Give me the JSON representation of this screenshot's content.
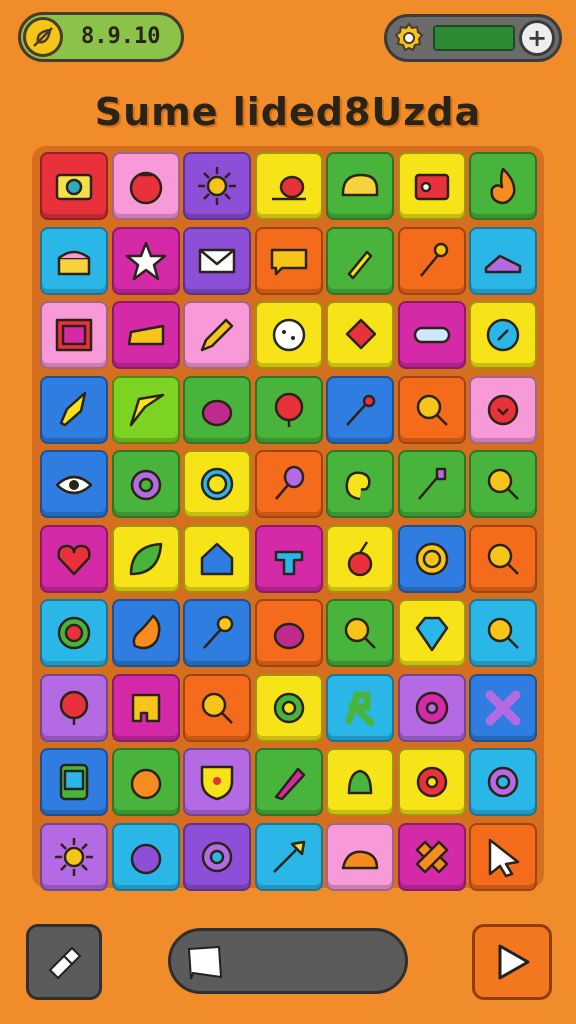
{
  "hud": {
    "coins": "8.9.10",
    "coin_icon": "leaf-icon",
    "settings_icon": "gear-icon",
    "add_icon": "plus-icon",
    "energy_level": 1.0
  },
  "title": "Sume lided8Uzda",
  "board": {
    "rows": 9,
    "cols": 7,
    "tiles": [
      [
        "red",
        "camera-icon"
      ],
      [
        "pink",
        "tomato-icon"
      ],
      [
        "purple",
        "sun-icon"
      ],
      [
        "yellow",
        "snail-icon"
      ],
      [
        "green",
        "bread-icon"
      ],
      [
        "yellow",
        "radio-icon"
      ],
      [
        "green",
        "flame-icon"
      ],
      [
        "cyan",
        "cake-icon"
      ],
      [
        "magenta",
        "star-icon"
      ],
      [
        "purple",
        "envelope-icon"
      ],
      [
        "orange",
        "speech-bubble-icon"
      ],
      [
        "green",
        "brush-icon"
      ],
      [
        "orange",
        "wrench-icon"
      ],
      [
        "cyan",
        "shoe-icon"
      ],
      [
        "pink",
        "frame-icon"
      ],
      [
        "magenta",
        "cheese-icon"
      ],
      [
        "pink",
        "pencil-icon"
      ],
      [
        "yellow",
        "cookie-icon"
      ],
      [
        "yellow",
        "tag-icon"
      ],
      [
        "magenta",
        "tube-icon"
      ],
      [
        "yellow",
        "compass-icon"
      ],
      [
        "blue",
        "rocket-icon"
      ],
      [
        "lime",
        "arrow-icon"
      ],
      [
        "green",
        "eggplant-icon"
      ],
      [
        "green",
        "balloon-icon"
      ],
      [
        "blue",
        "wand-icon"
      ],
      [
        "orange",
        "magnifier-icon"
      ],
      [
        "pink",
        "bird-icon"
      ],
      [
        "blue",
        "eye-icon"
      ],
      [
        "green",
        "plum-icon"
      ],
      [
        "yellow",
        "ring-icon"
      ],
      [
        "orange",
        "spoon-icon"
      ],
      [
        "green",
        "swirl-icon"
      ],
      [
        "green",
        "pen-icon"
      ],
      [
        "green",
        "magnifier-icon"
      ],
      [
        "magenta",
        "heart-icon"
      ],
      [
        "yellow",
        "leaf-icon"
      ],
      [
        "yellow",
        "house-icon"
      ],
      [
        "magenta",
        "tree-icon"
      ],
      [
        "yellow",
        "cherry-icon"
      ],
      [
        "blue",
        "spiral-icon"
      ],
      [
        "orange",
        "magnifier-icon"
      ],
      [
        "cyan",
        "target-icon"
      ],
      [
        "blue",
        "pear-icon"
      ],
      [
        "blue",
        "torch-icon"
      ],
      [
        "orange",
        "eggplant-icon"
      ],
      [
        "green",
        "magnifier-icon"
      ],
      [
        "yellow",
        "diamond-icon"
      ],
      [
        "cyan",
        "magnifier-icon"
      ],
      [
        "violet",
        "balloon-icon"
      ],
      [
        "magenta",
        "puzzle-icon"
      ],
      [
        "orange",
        "magnifier-icon"
      ],
      [
        "yellow",
        "flower-icon"
      ],
      [
        "cyan",
        "knot-icon"
      ],
      [
        "violet",
        "donut-icon"
      ],
      [
        "blue",
        "cross-icon"
      ],
      [
        "blue",
        "phone-icon"
      ],
      [
        "green",
        "orange-icon"
      ],
      [
        "violet",
        "shield-icon"
      ],
      [
        "green",
        "marker-icon"
      ],
      [
        "yellow",
        "bell-icon"
      ],
      [
        "yellow",
        "cog-icon"
      ],
      [
        "cyan",
        "gear-icon"
      ],
      [
        "violet",
        "sun-icon"
      ],
      [
        "cyan",
        "berry-icon"
      ],
      [
        "purple",
        "gear-icon"
      ],
      [
        "cyan",
        "dart-icon"
      ],
      [
        "pink",
        "squirrel-icon"
      ],
      [
        "magenta",
        "bandage-icon"
      ],
      [
        "orange",
        "cursor-icon"
      ]
    ]
  },
  "palette": {
    "red": "#e8313a",
    "pink": "#f79ad7",
    "purple": "#8e4fd8",
    "yellow": "#f7e418",
    "green": "#49b43c",
    "cyan": "#2bb6e8",
    "magenta": "#d42aa8",
    "orange": "#f46b1c",
    "blue": "#2f7de0",
    "lime": "#7dd321",
    "violet": "#b36ae2"
  },
  "controls": {
    "back_icon": "hammer-icon",
    "progress_icon": "flag-icon",
    "progress_level": 0.0,
    "play_icon": "play-icon"
  }
}
